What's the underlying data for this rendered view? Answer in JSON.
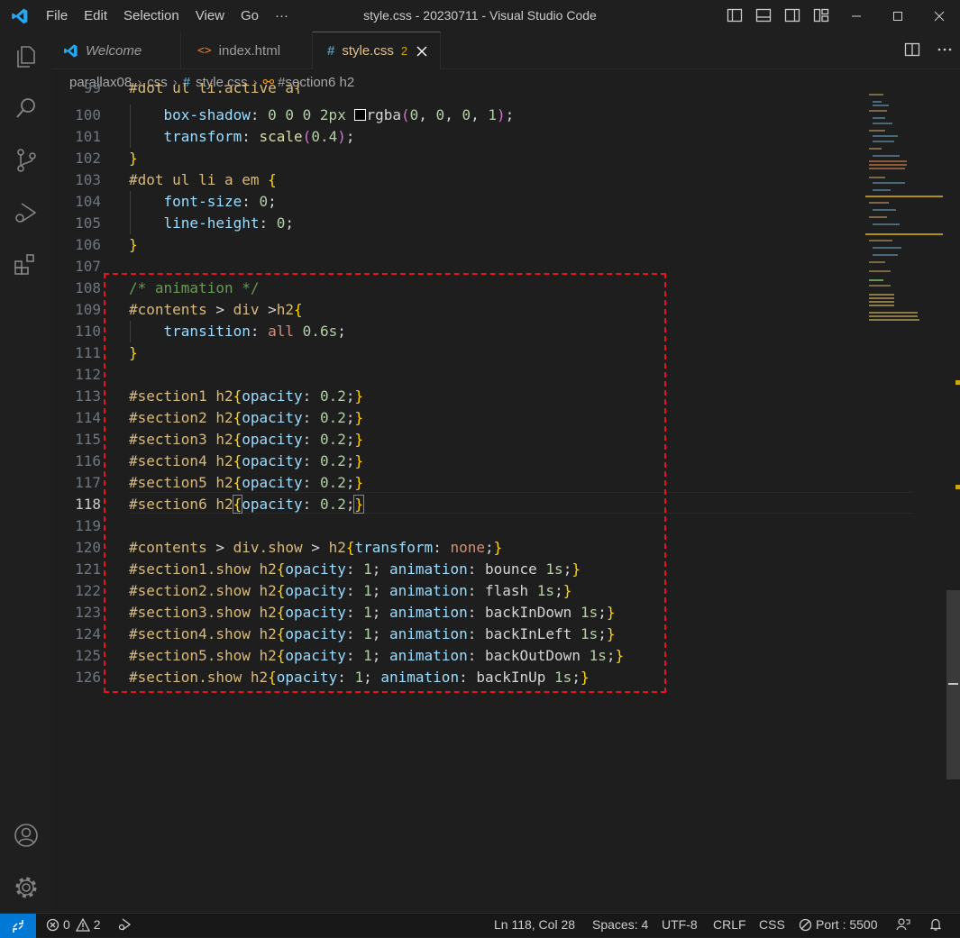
{
  "window": {
    "title": "style.css - 20230711 - Visual Studio Code"
  },
  "menu": [
    "File",
    "Edit",
    "Selection",
    "View",
    "Go",
    "···"
  ],
  "tabs": [
    {
      "label": "Welcome",
      "icon": "vscode-logo-icon"
    },
    {
      "label": "index.html",
      "icon": "html-code-icon"
    },
    {
      "label": "style.css",
      "icon": "hash-icon",
      "badge": "2"
    }
  ],
  "breadcrumb": [
    "parallax08",
    "css",
    "style.css",
    "#section6 h2"
  ],
  "editor": {
    "current_line": 118,
    "line_numbers": [
      "99",
      "100",
      "101",
      "102",
      "103",
      "104",
      "105",
      "106",
      "107",
      "108",
      "109",
      "110",
      "111",
      "112",
      "113",
      "114",
      "115",
      "116",
      "117",
      "118",
      "119",
      "120",
      "121",
      "122",
      "123",
      "124",
      "125",
      "126"
    ],
    "partial_line_text": "#dot ul li.active a{"
  },
  "status": {
    "errors": "0",
    "warnings": "2",
    "position": "Ln 118, Col 28",
    "spaces": "Spaces: 4",
    "encoding": "UTF-8",
    "eol": "CRLF",
    "language": "CSS",
    "port": "Port : 5500"
  },
  "colors": {
    "accent": "#0078d4",
    "highlight_box": "#e81123",
    "selector": "#d7ba7d",
    "property": "#9cdcfe",
    "number": "#b5cea8",
    "comment": "#6a9955"
  }
}
